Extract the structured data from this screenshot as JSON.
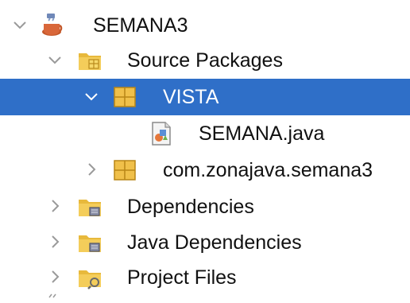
{
  "tree": {
    "items": [
      {
        "label": "SEMANA3",
        "expanded": true,
        "icon": "java-project-icon"
      },
      {
        "label": "Source Packages",
        "expanded": true,
        "icon": "source-folder-icon"
      },
      {
        "label": "VISTA",
        "expanded": true,
        "selected": true,
        "icon": "package-icon"
      },
      {
        "label": "SEMANA.java",
        "icon": "java-file-icon"
      },
      {
        "label": "com.zonajava.semana3",
        "expanded": false,
        "icon": "package-icon"
      },
      {
        "label": "Dependencies",
        "expanded": false,
        "icon": "dependencies-folder-icon"
      },
      {
        "label": "Java Dependencies",
        "expanded": false,
        "icon": "dependencies-folder-icon"
      },
      {
        "label": "Project Files",
        "expanded": false,
        "icon": "project-files-folder-icon"
      }
    ]
  },
  "colors": {
    "selection": "#2f6fc8",
    "folder": "#e8b93c",
    "package": "#e0a92c",
    "chevron": "#9a9a9a"
  }
}
